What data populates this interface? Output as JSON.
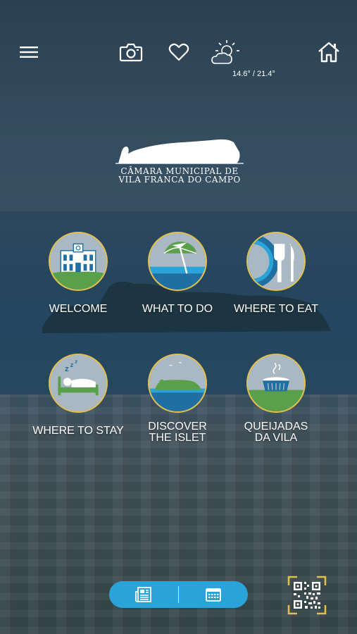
{
  "header": {
    "weather_temp": "14.6° / 21.4°",
    "icons": [
      "menu-icon",
      "camera-icon",
      "heart-icon",
      "weather-icon",
      "home-icon"
    ]
  },
  "logo": {
    "line1": "Câmara Municipal de",
    "line2": "Vila Franca do Campo"
  },
  "tiles": [
    {
      "label": "WELCOME"
    },
    {
      "label": "WHAT TO DO"
    },
    {
      "label": "WHERE TO EAT"
    },
    {
      "label": "WHERE TO STAY"
    },
    {
      "label_line1": "DISCOVER",
      "label_line2": "THE ISLET"
    },
    {
      "label_line1": "QUEIJADAS",
      "label_line2": "DA VILA"
    }
  ],
  "footer": {
    "icons": [
      "newspaper-icon",
      "calendar-icon",
      "qr-code-icon"
    ]
  },
  "colors": {
    "accent_gold": "#e2c04a",
    "pill_blue": "#2aa3d9",
    "icon_blue": "#1f6fa3",
    "icon_green": "#5aa04a"
  }
}
